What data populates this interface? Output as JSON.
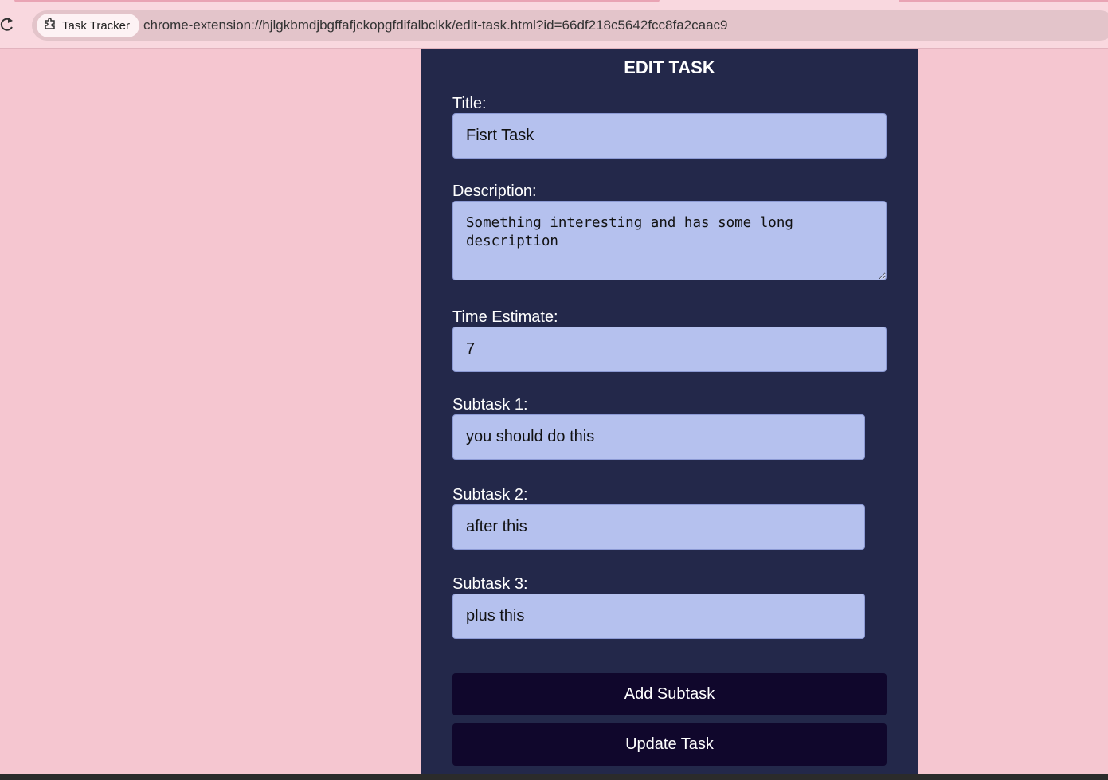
{
  "browser": {
    "site_chip_label": "Task Tracker",
    "url": "chrome-extension://hjlgkbmdjbgffafjckopgfdifalbclkk/edit-task.html?id=66df218c5642fcc8fa2caac9",
    "reload_icon": "reload-icon",
    "extension_icon": "puzzle-icon"
  },
  "form": {
    "heading": "EDIT TASK",
    "title_label": "Title:",
    "title_value": "Fisrt Task",
    "description_label": "Description:",
    "description_value": "Something interesting and has some long description",
    "time_estimate_label": "Time Estimate:",
    "time_estimate_value": "7",
    "subtasks": [
      {
        "label": "Subtask 1:",
        "value": "you should do this"
      },
      {
        "label": "Subtask 2:",
        "value": "after this"
      },
      {
        "label": "Subtask 3:",
        "value": "plus this"
      }
    ],
    "add_subtask_label": "Add Subtask",
    "update_task_label": "Update Task"
  },
  "colors": {
    "page_background": "#f5c6d0",
    "panel_background": "#23284a",
    "input_background": "#b5c1ee",
    "button_background": "#10072c"
  }
}
